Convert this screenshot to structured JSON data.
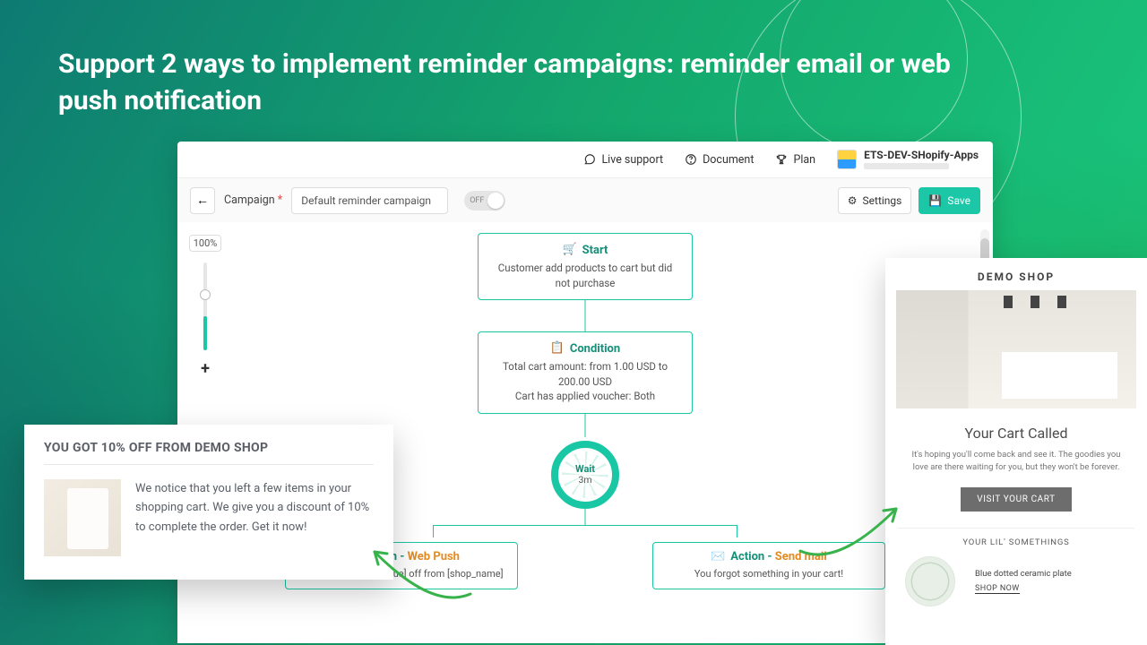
{
  "headline": "Support 2 ways to implement reminder campaigns: reminder email or web push notification",
  "topbar": {
    "support": "Live support",
    "document": "Document",
    "plan": "Plan",
    "user": "ETS-DEV-SHopify-Apps"
  },
  "toolbar": {
    "label": "Campaign",
    "asterisk": "*",
    "name_value": "Default reminder campaign",
    "toggle": "OFF",
    "settings": "Settings",
    "save": "Save"
  },
  "zoom": {
    "percent": "100%",
    "plus": "+"
  },
  "flow": {
    "start": {
      "title": "Start",
      "body": "Customer add products to cart but did not purchase"
    },
    "condition": {
      "title": "Condition",
      "line1": "Total cart amount: from 1.00 USD to 200.00 USD",
      "line2": "Cart has applied voucher: Both"
    },
    "wait": {
      "title": "Wait",
      "value": "3m"
    },
    "action_push": {
      "prefix": "Action - ",
      "kind": "Web Push",
      "body": "You got [discount_value] off from [shop_name]"
    },
    "action_mail": {
      "prefix": "Action - ",
      "kind": "Send mail",
      "body": "You forgot something in your cart!"
    }
  },
  "push_preview": {
    "title": "YOU GOT 10% OFF FROM DEMO SHOP",
    "body": "We notice that you left a few items in your shopping cart. We give you a discount of 10% to complete the order. Get it now!"
  },
  "email_preview": {
    "brand": "DEMO SHOP",
    "heading": "Your Cart Called",
    "lead": "It's hoping you'll come back and see it. The goodies you love are there waiting for you, but they won't be forever.",
    "cta": "VISIT YOUR CART",
    "subhead": "YOUR LIL' SOMETHINGS",
    "product_name": "Blue dotted ceramic plate",
    "shop_now": "SHOP NOW"
  },
  "colors": {
    "accent": "#19c7a4"
  }
}
